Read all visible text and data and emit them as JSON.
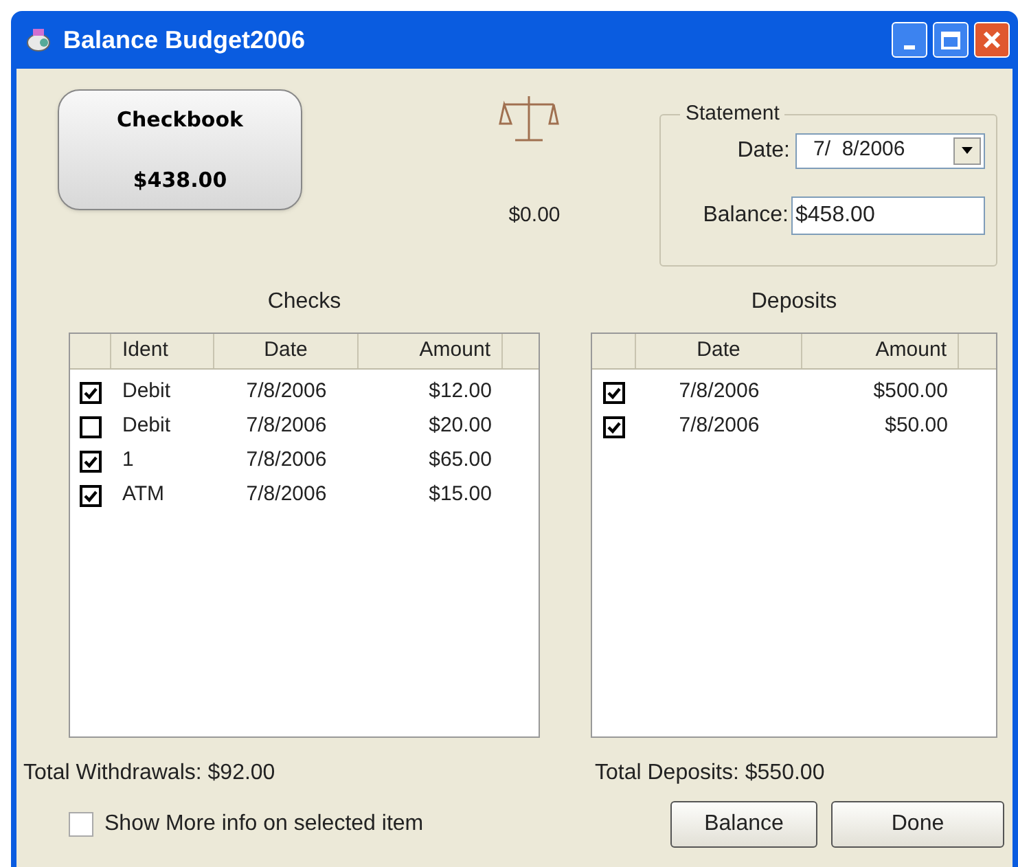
{
  "window": {
    "title": "Balance Budget2006"
  },
  "checkbook": {
    "label": "Checkbook",
    "amount": "$438.00"
  },
  "difference": "$0.00",
  "statement": {
    "title": "Statement",
    "date_label": "Date:",
    "date": "7/  8/2006",
    "balance_label": "Balance:",
    "balance": "$458.00"
  },
  "checks": {
    "title": "Checks",
    "columns": [
      "Ident",
      "Date",
      "Amount"
    ],
    "rows": [
      {
        "checked": true,
        "ident": "Debit",
        "date": "7/8/2006",
        "amount": "$12.00"
      },
      {
        "checked": false,
        "ident": "Debit",
        "date": "7/8/2006",
        "amount": "$20.00"
      },
      {
        "checked": true,
        "ident": "1",
        "date": "7/8/2006",
        "amount": "$65.00"
      },
      {
        "checked": true,
        "ident": "ATM",
        "date": "7/8/2006",
        "amount": "$15.00"
      }
    ],
    "total": "Total Withdrawals: $92.00"
  },
  "deposits": {
    "title": "Deposits",
    "columns": [
      "Date",
      "Amount"
    ],
    "rows": [
      {
        "checked": true,
        "date": "7/8/2006",
        "amount": "$500.00"
      },
      {
        "checked": true,
        "date": "7/8/2006",
        "amount": "$50.00"
      }
    ],
    "total": "Total Deposits: $550.00"
  },
  "show_more": {
    "label": "Show More info on selected item",
    "checked": false
  },
  "buttons": [
    "Balance",
    "Done"
  ]
}
